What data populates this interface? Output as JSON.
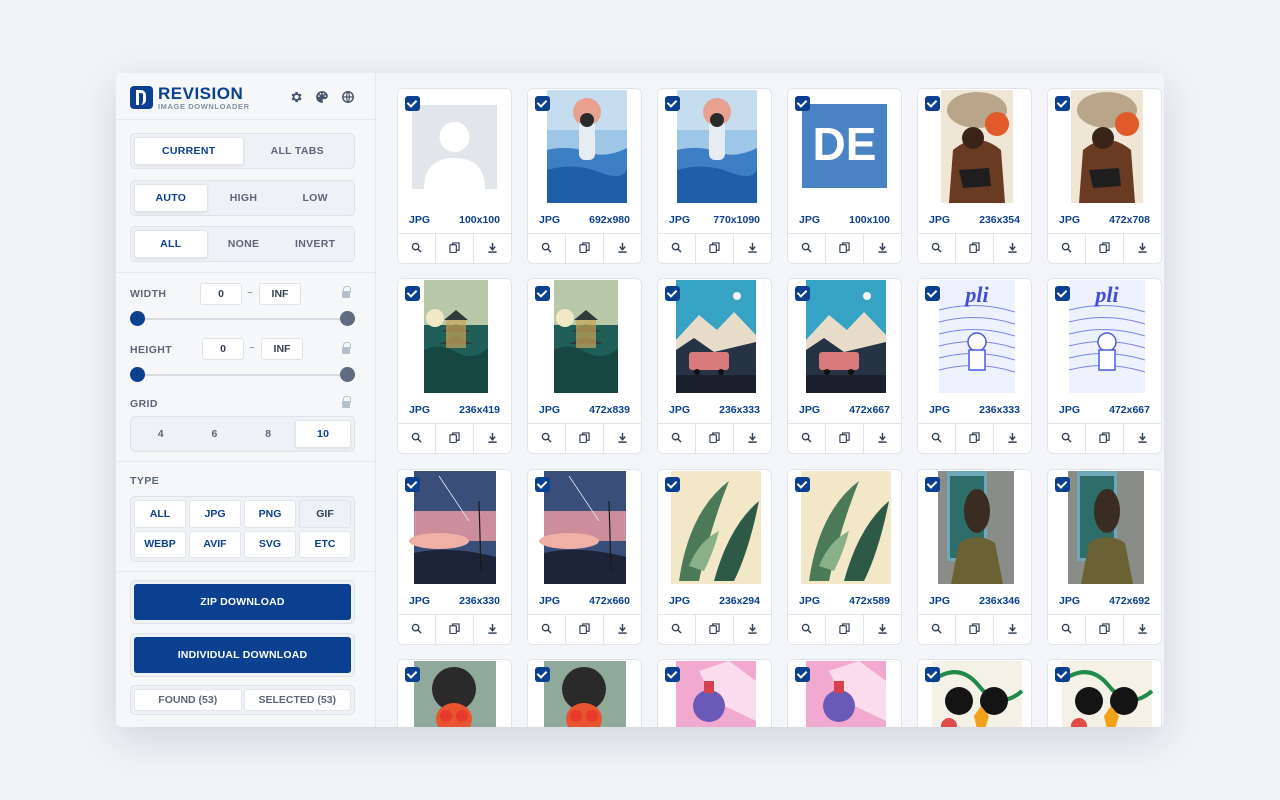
{
  "brand": {
    "name": "REVISION",
    "subtitle": "IMAGE DOWNLOADER"
  },
  "header_icons": [
    "gear-icon",
    "palette-icon",
    "globe-icon"
  ],
  "scope": {
    "options": [
      "CURRENT",
      "ALL TABS"
    ],
    "selected": "CURRENT"
  },
  "quality": {
    "options": [
      "AUTO",
      "HIGH",
      "LOW"
    ],
    "selected": "AUTO"
  },
  "selection": {
    "options": [
      "ALL",
      "NONE",
      "INVERT"
    ],
    "selected": "ALL"
  },
  "width": {
    "label": "WIDTH",
    "min": "0",
    "separator": "~",
    "max": "INF"
  },
  "height": {
    "label": "HEIGHT",
    "min": "0",
    "separator": "~",
    "max": "INF"
  },
  "grid": {
    "label": "GRID",
    "options": [
      "4",
      "6",
      "8",
      "10"
    ],
    "selected": "10"
  },
  "type": {
    "label": "TYPE",
    "options": [
      "ALL",
      "JPG",
      "PNG",
      "GIF",
      "WEBP",
      "AVIF",
      "SVG",
      "ETC"
    ],
    "disabled": [
      "GIF"
    ]
  },
  "buttons": {
    "zip": "ZIP DOWNLOAD",
    "individual": "INDIVIDUAL DOWNLOAD"
  },
  "stats": {
    "found": "FOUND (53)",
    "selected": "SELECTED (53)"
  },
  "colors": {
    "accent": "#0b3f8f",
    "knob_min": "#0b3f8f",
    "knob_max": "#5f6b80"
  },
  "images": [
    {
      "format": "JPG",
      "size": "100x100",
      "art": "placeholder"
    },
    {
      "format": "JPG",
      "size": "692x980",
      "art": "sea"
    },
    {
      "format": "JPG",
      "size": "770x1090",
      "art": "sea"
    },
    {
      "format": "JPG",
      "size": "100x100",
      "art": "de",
      "text": "DE"
    },
    {
      "format": "JPG",
      "size": "236x354",
      "art": "smoke"
    },
    {
      "format": "JPG",
      "size": "472x708",
      "art": "smoke"
    },
    {
      "format": "JPG",
      "size": "236x419",
      "art": "pagoda"
    },
    {
      "format": "JPG",
      "size": "472x839",
      "art": "pagoda"
    },
    {
      "format": "JPG",
      "size": "236x333",
      "art": "mountain"
    },
    {
      "format": "JPG",
      "size": "472x667",
      "art": "mountain"
    },
    {
      "format": "JPG",
      "size": "236x333",
      "art": "poster",
      "text": "pli"
    },
    {
      "format": "JPG",
      "size": "472x667",
      "art": "poster",
      "text": "pli"
    },
    {
      "format": "JPG",
      "size": "236x330",
      "art": "dusk"
    },
    {
      "format": "JPG",
      "size": "472x660",
      "art": "dusk"
    },
    {
      "format": "JPG",
      "size": "236x294",
      "art": "leaves"
    },
    {
      "format": "JPG",
      "size": "472x589",
      "art": "leaves"
    },
    {
      "format": "JPG",
      "size": "236x346",
      "art": "window"
    },
    {
      "format": "JPG",
      "size": "472x692",
      "art": "window"
    },
    {
      "format": "",
      "size": "",
      "art": "green"
    },
    {
      "format": "",
      "size": "",
      "art": "green"
    },
    {
      "format": "",
      "size": "",
      "art": "pink"
    },
    {
      "format": "",
      "size": "",
      "art": "pink"
    },
    {
      "format": "",
      "size": "",
      "art": "floral"
    },
    {
      "format": "",
      "size": "",
      "art": "floral"
    }
  ]
}
